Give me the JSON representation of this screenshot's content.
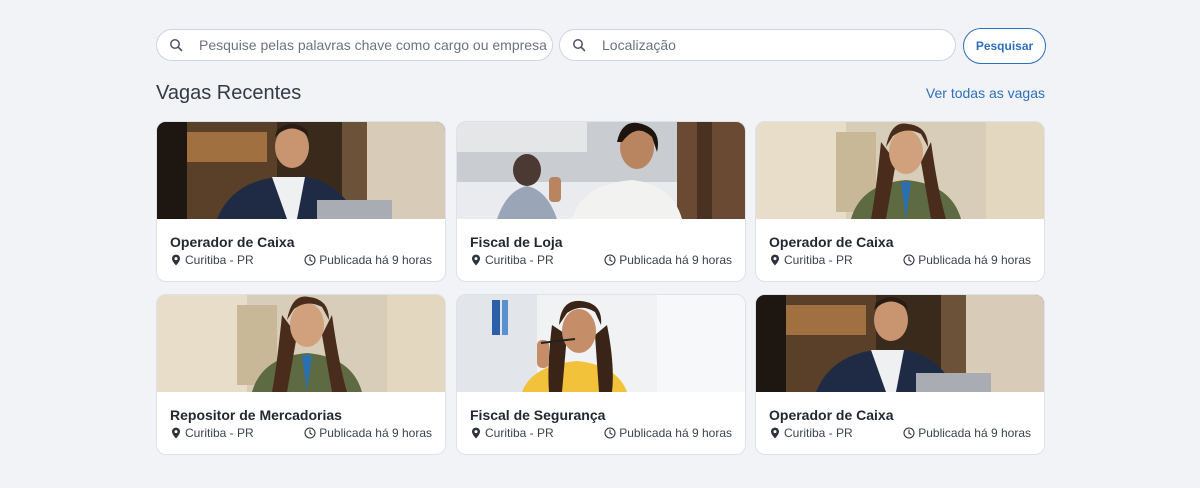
{
  "search": {
    "keyword_placeholder": "Pesquise pelas palavras chave como cargo ou empresa",
    "keyword_value": "",
    "location_placeholder": "Localização",
    "location_value": "",
    "button_label": "Pesquisar",
    "search_icon": "search-icon"
  },
  "section": {
    "title": "Vagas Recentes",
    "see_all_label": "Ver todas as vagas"
  },
  "jobs": [
    {
      "title": "Operador de Caixa",
      "location": "Curitiba - PR",
      "posted": "Publicada há 9 horas",
      "photo": "man-office-laptop-photo"
    },
    {
      "title": "Fiscal de Loja",
      "location": "Curitiba - PR",
      "posted": "Publicada há 9 horas",
      "photo": "woman-thumbs-up-photo"
    },
    {
      "title": "Operador de Caixa",
      "location": "Curitiba - PR",
      "posted": "Publicada há 9 horas",
      "photo": "woman-smiling-office-photo"
    },
    {
      "title": "Repositor de Mercadorias",
      "location": "Curitiba - PR",
      "posted": "Publicada há 9 horas",
      "photo": "woman-smiling-office-photo"
    },
    {
      "title": "Fiscal de Segurança",
      "location": "Curitiba - PR",
      "posted": "Publicada há 9 horas",
      "photo": "woman-pen-thinking-photo"
    },
    {
      "title": "Operador de Caixa",
      "location": "Curitiba - PR",
      "posted": "Publicada há 9 horas",
      "photo": "man-office-laptop-photo"
    }
  ],
  "colors": {
    "accent": "#2f6fba",
    "background": "#f1f3f6",
    "card": "#ffffff"
  }
}
